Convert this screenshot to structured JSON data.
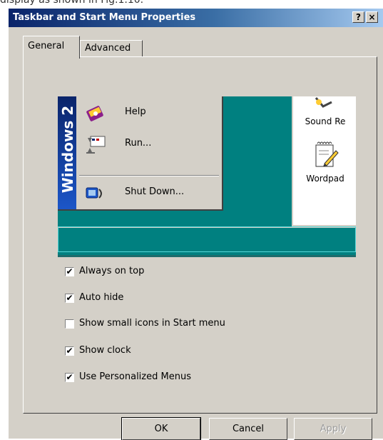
{
  "caption_fragment": "display as shown in Fig.1.10.",
  "dialog": {
    "title": "Taskbar and Start Menu Properties",
    "help_button": "?",
    "close_button": "×"
  },
  "tabs": [
    {
      "label": "General",
      "active": true
    },
    {
      "label": "Advanced",
      "active": false
    }
  ],
  "preview": {
    "banner_text": "Windows 2",
    "start_menu_items": [
      {
        "label": "Help",
        "icon": "help-book-icon"
      },
      {
        "label": "Run...",
        "icon": "run-icon"
      },
      {
        "label": "Shut Down...",
        "icon": "shut-down-icon"
      }
    ],
    "window_items": [
      {
        "label": "Sound Re",
        "icon": "sound-recorder-icon"
      },
      {
        "label": "Wordpad",
        "icon": "wordpad-icon"
      }
    ],
    "colors": {
      "desktop": "#008080",
      "title_start": "#0a246a",
      "title_end": "#a6caf0"
    }
  },
  "options": [
    {
      "label": "Always on top",
      "checked": true
    },
    {
      "label": "Auto hide",
      "checked": true
    },
    {
      "label": "Show small icons in Start menu",
      "checked": false
    },
    {
      "label": "Show clock",
      "checked": true
    },
    {
      "label": "Use Personalized Menus",
      "checked": true
    }
  ],
  "buttons": {
    "ok": "OK",
    "cancel": "Cancel",
    "apply": "Apply"
  },
  "check_mark": "✔"
}
